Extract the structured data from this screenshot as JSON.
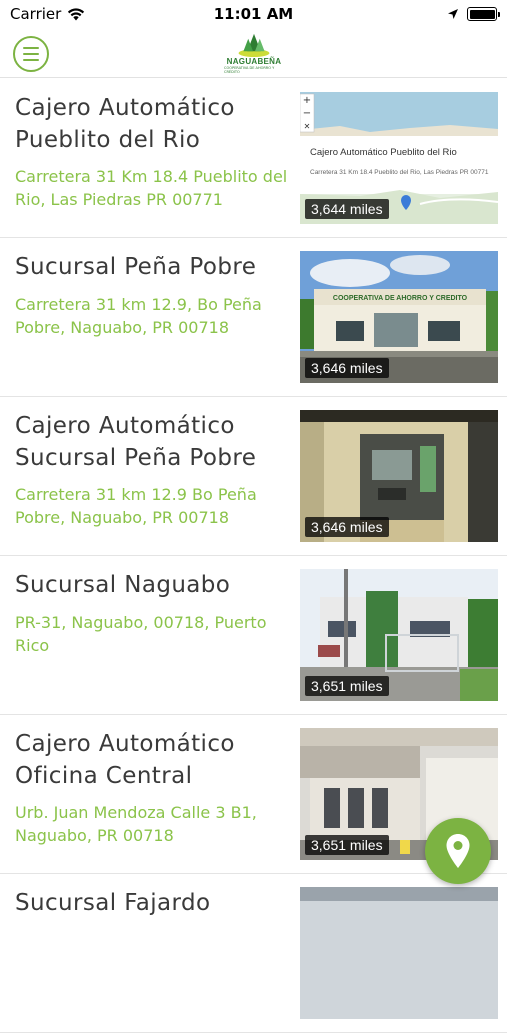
{
  "status_bar": {
    "carrier": "Carrier",
    "time": "11:01 AM"
  },
  "header": {
    "logo_text": "NAGUABEÑA",
    "logo_subtext": "COOPERATIVA DE AHORRO Y CRÉDITO"
  },
  "locations": [
    {
      "title": "Cajero Automático Pueblito del Rio",
      "address": "Carretera 31 Km 18.4 Pueblito del Rio, Las Piedras PR 00771",
      "distance": "3,644 miles",
      "image": "map",
      "map_card": {
        "title": "Cajero Automático Pueblito del Rio",
        "address": "Carretera 31 Km 18.4 Pueblito del Rio, Las Piedras PR 00771"
      }
    },
    {
      "title": "Sucursal Peña Pobre",
      "address": "Carretera 31 km 12.9, Bo Peña Pobre, Naguabo, PR 00718",
      "distance": "3,646 miles",
      "image": "building-sign",
      "sign_text": "COOPERATIVA DE AHORRO Y CREDITO"
    },
    {
      "title": "Cajero Automático Sucursal Peña Pobre",
      "address": "Carretera 31 km 12.9 Bo Peña Pobre, Naguabo, PR 00718",
      "distance": "3,646 miles",
      "image": "atm"
    },
    {
      "title": "Sucursal Naguabo",
      "address": "PR-31, Naguabo, 00718, Puerto Rico",
      "distance": "3,651 miles",
      "image": "branch"
    },
    {
      "title": "Cajero Automático Oficina Central",
      "address": "Urb. Juan Mendoza Calle 3 B1, Naguabo, PR 00718",
      "distance": "3,651 miles",
      "image": "office"
    },
    {
      "title": "Sucursal Fajardo",
      "address": "",
      "distance": "",
      "image": "partial"
    }
  ],
  "colors": {
    "accent": "#7cb342",
    "title": "#3a3a3a",
    "address": "#8bc34a"
  },
  "icons": {
    "menu": "hamburger-icon",
    "map_fab": "map-pin-icon"
  }
}
